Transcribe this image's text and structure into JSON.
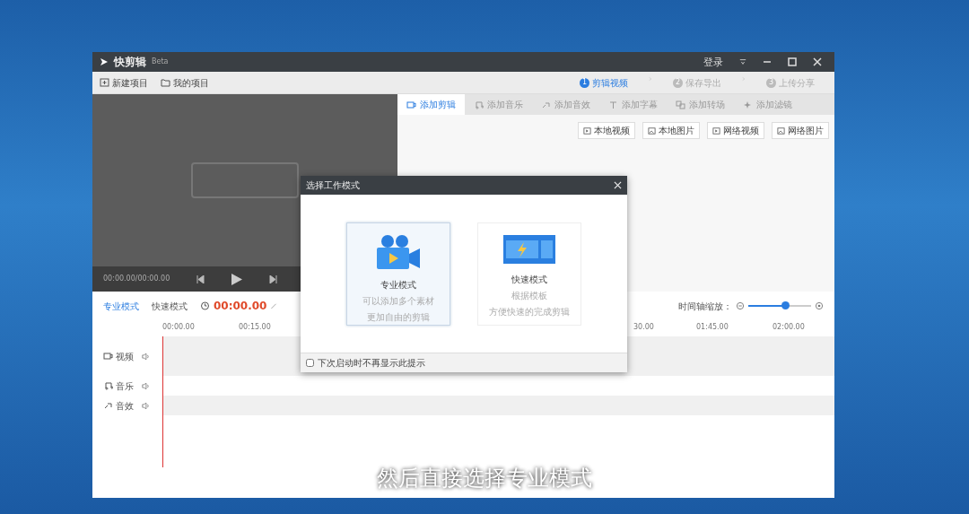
{
  "app": {
    "title": "快剪辑",
    "badge": "Beta",
    "login": "登录"
  },
  "toolbar": [
    {
      "label": "新建项目"
    },
    {
      "label": "我的项目"
    }
  ],
  "steps": [
    {
      "number": "1",
      "label": "剪辑视频",
      "selected": true
    },
    {
      "number": "2",
      "label": "保存导出",
      "selected": false
    },
    {
      "number": "3",
      "label": "上传分享",
      "selected": false
    }
  ],
  "preview": {
    "time": "00:00.00/00:00.00"
  },
  "tabs": [
    {
      "label": "添加剪辑",
      "selected": true
    },
    {
      "label": "添加音乐",
      "selected": false
    },
    {
      "label": "添加音效",
      "selected": false
    },
    {
      "label": "添加字幕",
      "selected": false
    },
    {
      "label": "添加转场",
      "selected": false
    },
    {
      "label": "添加滤镜",
      "selected": false
    }
  ],
  "source_buttons": [
    "本地视频",
    "本地图片",
    "网络视频",
    "网络图片"
  ],
  "timeline": {
    "modes": [
      {
        "label": "专业模式",
        "selected": true
      },
      {
        "label": "快速模式",
        "selected": false
      }
    ],
    "timecode": "00:00.00",
    "zoom_label": "时间轴缩放：",
    "zoom": {
      "level": 0.58
    },
    "ruler": [
      "00:00.00",
      "00:15.00",
      "30.00",
      "01:45.00",
      "02:00.00"
    ],
    "tracks": [
      {
        "label": "视频"
      },
      {
        "label": "音乐"
      },
      {
        "label": "音效"
      }
    ]
  },
  "dialog": {
    "title": "选择工作模式",
    "options": [
      {
        "kind": "pro",
        "title": "专业模式",
        "lines": [
          "可以添加多个素材",
          "更加自由的剪辑"
        ],
        "selected": true
      },
      {
        "kind": "quick",
        "title": "快速模式",
        "lines": [
          "根据模板",
          "方便快速的完成剪辑"
        ],
        "selected": false
      }
    ],
    "dont_show": {
      "label": "下次启动时不再显示此提示",
      "checked": false
    }
  },
  "subtitle": "然后直接选择专业模式"
}
